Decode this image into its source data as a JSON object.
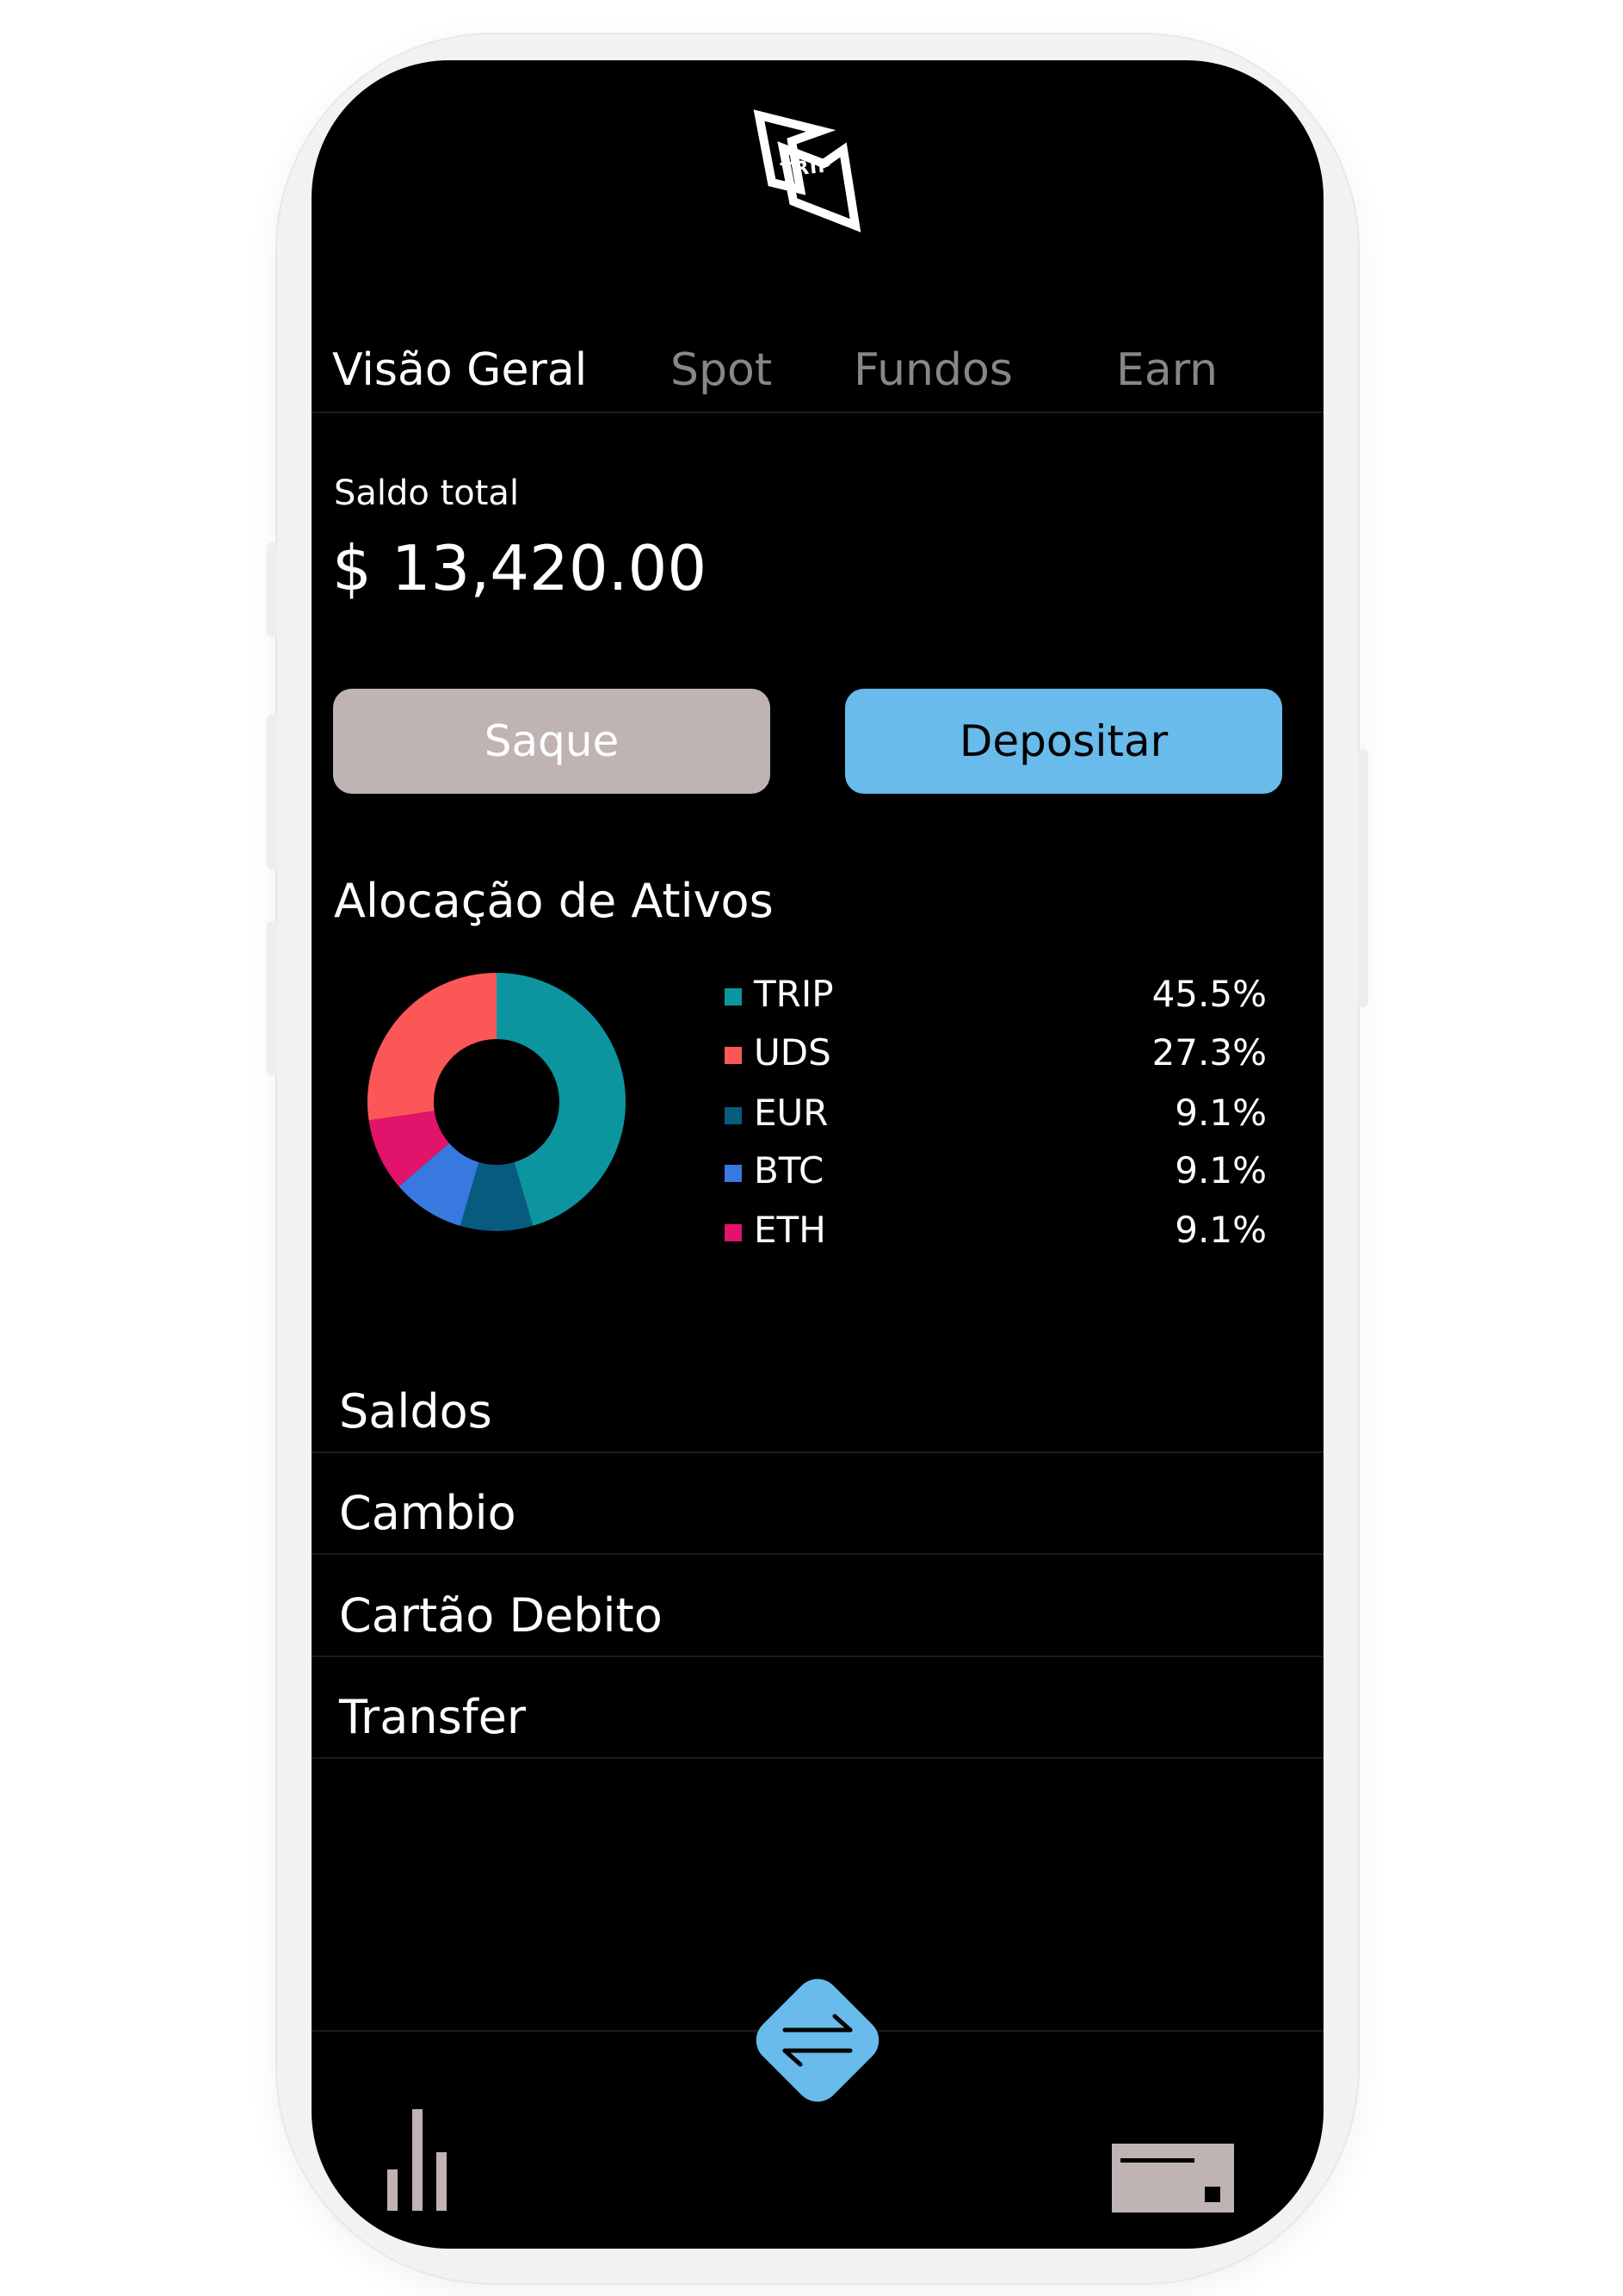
{
  "logo": {
    "text": "TRIP"
  },
  "tabs": [
    {
      "label": "Visão Geral",
      "active": true
    },
    {
      "label": "Spot",
      "active": false
    },
    {
      "label": "Fundos",
      "active": false
    },
    {
      "label": "Earn",
      "active": false
    }
  ],
  "balance": {
    "label": "Saldo total",
    "value": "$ 13,420.00"
  },
  "actions": {
    "withdraw_label": "Saque",
    "deposit_label": "Depositar"
  },
  "allocation": {
    "title": "Alocação de Ativos",
    "items": [
      {
        "name": "TRIP",
        "percent": "45.5%"
      },
      {
        "name": "UDS",
        "percent": "27.3%"
      },
      {
        "name": "EUR",
        "percent": "9.1%"
      },
      {
        "name": "BTC",
        "percent": "9.1%"
      },
      {
        "name": "ETH",
        "percent": "9.1%"
      }
    ]
  },
  "chart_data": {
    "type": "pie",
    "categories": [
      "TRIP",
      "UDS",
      "EUR",
      "BTC",
      "ETH"
    ],
    "values": [
      45.5,
      27.3,
      9.1,
      9.1,
      9.1
    ],
    "slice_order_clockwise_from_top": [
      "TRIP",
      "EUR",
      "BTC",
      "ETH",
      "UDS"
    ],
    "colors": {
      "TRIP": "#0c959f",
      "UDS": "#fc5757",
      "EUR": "#075b7e",
      "BTC": "#3879e0",
      "ETH": "#e1136b"
    },
    "donut": true,
    "title": "Alocação de Ativos",
    "legend_placement": "right"
  },
  "menu": [
    {
      "label": "Saldos"
    },
    {
      "label": "Cambio"
    },
    {
      "label": "Cartão Debito"
    },
    {
      "label": "Transfer"
    }
  ],
  "nav": {
    "left_icon": "bar-chart-icon",
    "center_icon": "swap-arrows-icon",
    "right_icon": "card-icon"
  },
  "colors": {
    "background": "#000000",
    "accent": "#68bbea",
    "muted_button": "#bfb3b3",
    "inactive_tab": "#8a8683"
  }
}
